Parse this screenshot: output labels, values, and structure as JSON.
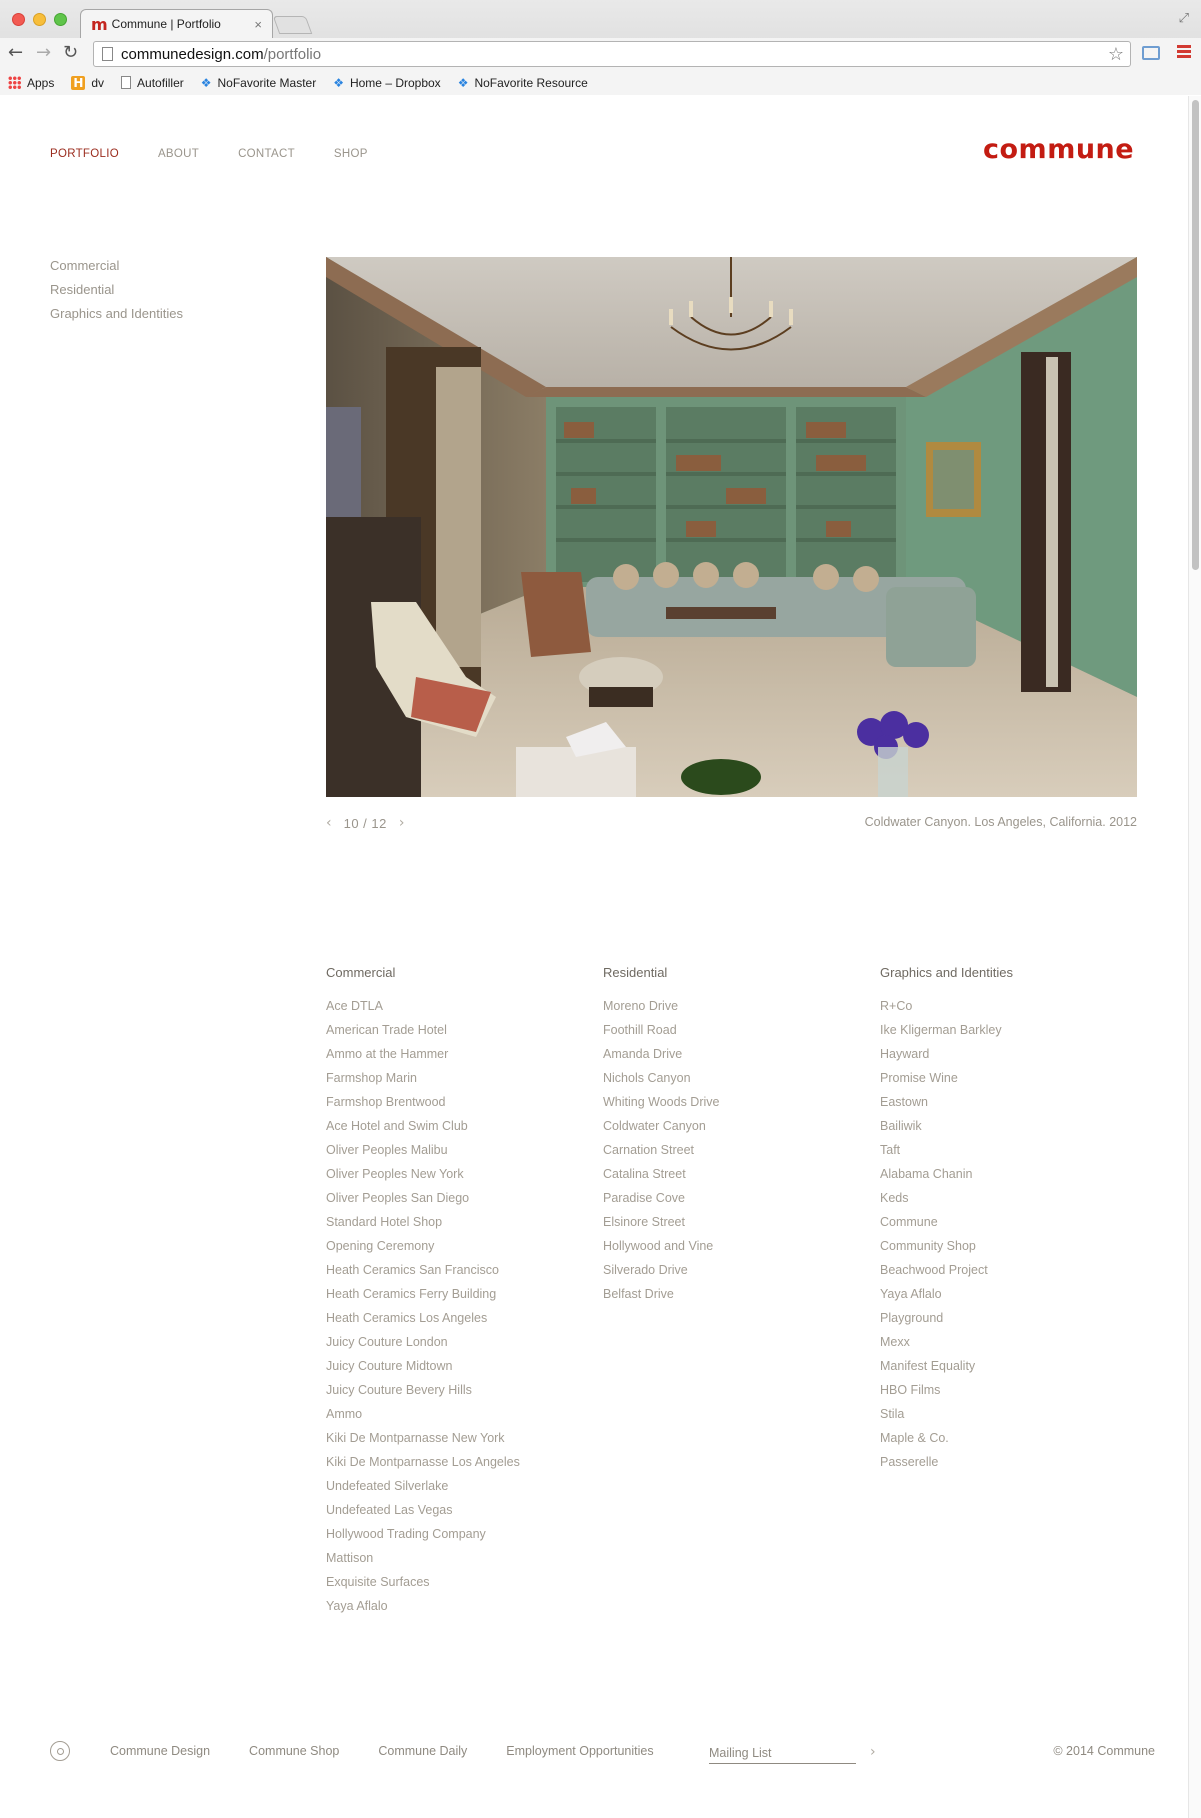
{
  "browser": {
    "tab_title": "Commune | Portfolio",
    "tab_favicon": "m",
    "tab_close": "×",
    "url_host": "communedesign.com",
    "url_path": "/portfolio",
    "bookmarks": [
      {
        "label": "Apps",
        "icon": "apps-icon"
      },
      {
        "label": "dv",
        "icon": "h-icon"
      },
      {
        "label": "Autofiller",
        "icon": "page-icon"
      },
      {
        "label": "NoFavorite Master",
        "icon": "dropbox-icon"
      },
      {
        "label": "Home – Dropbox",
        "icon": "dropbox-icon"
      },
      {
        "label": "NoFavorite Resource",
        "icon": "dropbox-icon"
      }
    ]
  },
  "nav": {
    "items": [
      "PORTFOLIO",
      "ABOUT",
      "CONTACT",
      "SHOP"
    ],
    "active": "PORTFOLIO"
  },
  "logo": "commune",
  "sidebar": [
    "Commercial",
    "Residential",
    "Graphics and Identities"
  ],
  "slideshow": {
    "prev": "‹",
    "counter": "10 / 12",
    "next": "›",
    "caption": "Coldwater Canyon. Los Angeles, California. 2012"
  },
  "columns": [
    {
      "heading": "Commercial",
      "items": [
        "Ace DTLA",
        "American Trade Hotel",
        "Ammo at the Hammer",
        "Farmshop Marin",
        "Farmshop Brentwood",
        "Ace Hotel and Swim Club",
        "Oliver Peoples Malibu",
        "Oliver Peoples New York",
        "Oliver Peoples San Diego",
        "Standard Hotel Shop",
        "Opening Ceremony",
        "Heath Ceramics San Francisco",
        "Heath Ceramics Ferry Building",
        "Heath Ceramics Los Angeles",
        "Juicy Couture London",
        "Juicy Couture Midtown",
        "Juicy Couture Bevery Hills",
        "Ammo",
        "Kiki De Montparnasse New York",
        "Kiki De Montparnasse Los Angeles",
        "Undefeated Silverlake",
        "Undefeated Las Vegas",
        "Hollywood Trading Company",
        "Mattison",
        "Exquisite Surfaces",
        "Yaya Aflalo"
      ]
    },
    {
      "heading": "Residential",
      "items": [
        "Moreno Drive",
        "Foothill Road",
        "Amanda Drive",
        "Nichols Canyon",
        "Whiting Woods Drive",
        "Coldwater Canyon",
        "Carnation Street",
        "Catalina Street",
        "Paradise Cove",
        "Elsinore Street",
        "Hollywood and Vine",
        "Silverado Drive",
        "Belfast Drive"
      ]
    },
    {
      "heading": "Graphics and Identities",
      "items": [
        "R+Co",
        "Ike Kligerman Barkley",
        "Hayward",
        "Promise Wine",
        "Eastown",
        "Bailiwik",
        "Taft",
        "Alabama Chanin",
        "Keds",
        "Commune",
        "Community Shop",
        "Beachwood Project",
        "Yaya Aflalo",
        "Playground",
        "Mexx",
        "Manifest Equality",
        "HBO Films",
        "Stila",
        "Maple & Co.",
        "Passerelle"
      ]
    }
  ],
  "footer": {
    "links": [
      "Commune Design",
      "Commune Shop",
      "Commune Daily",
      "Employment Opportunities"
    ],
    "mailing_placeholder": "Mailing List",
    "mailing_arrow": "›",
    "copyright": "© 2014 Commune"
  },
  "colors": {
    "brand": "#c31c12",
    "active_nav": "#9b2d1f",
    "text": "#9a958c"
  }
}
